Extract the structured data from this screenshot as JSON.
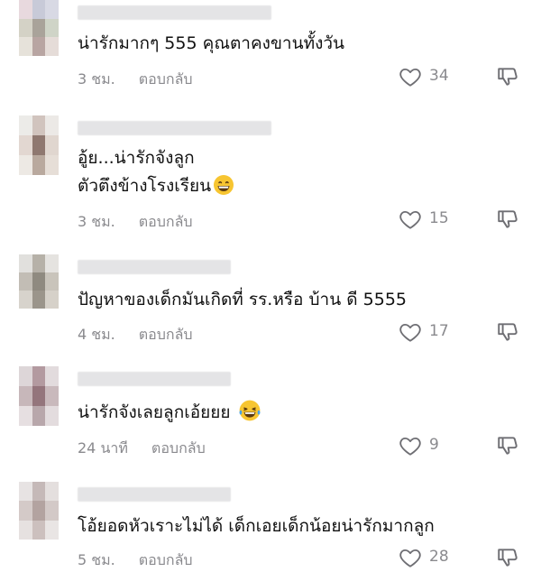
{
  "comments": [
    {
      "text_lines": [
        "น่ารักมากๆ 555 คุณตาคงขานทั้งวัน"
      ],
      "time": "3 ชม.",
      "reply": "ตอบกลับ",
      "likes": "34",
      "emoji": null
    },
    {
      "text_lines": [
        "อู้ย...น่ารักจังลูก",
        "ตัวตึงข้างโรงเรียน"
      ],
      "time": "3 ชม.",
      "reply": "ตอบกลับ",
      "likes": "15",
      "emoji": "grinning-face"
    },
    {
      "text_lines": [
        "ปัญหาของเด็กมันเกิดที่  รร.หรือ บ้าน ดี  5555"
      ],
      "time": "4 ชม.",
      "reply": "ตอบกลับ",
      "likes": "17",
      "emoji": null
    },
    {
      "text_lines": [
        "น่ารักจังเลยลูกเอ้ยยย"
      ],
      "time": "24 นาที",
      "reply": "ตอบกลับ",
      "likes": "9",
      "emoji": "laughing-tears-face"
    },
    {
      "text_lines": [
        "โอ้ยอดหัวเราะไม่ได้ เด็กเอยเด็กน้อยน่ารักมากลูก"
      ],
      "time": "5 ชม.",
      "reply": "ตอบกลับ",
      "likes": "28",
      "emoji": null
    }
  ],
  "colors": {
    "meta": "#8a8a8e",
    "text": "#111111",
    "blur": "#e4e4e6"
  }
}
